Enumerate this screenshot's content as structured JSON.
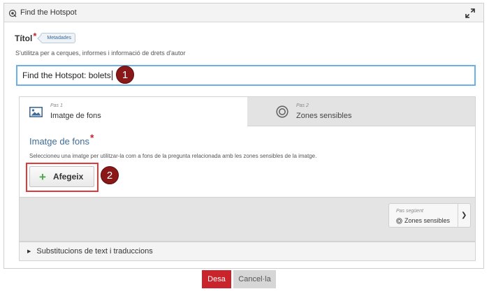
{
  "panel": {
    "title": "Find the Hotspot"
  },
  "title_field": {
    "label": "Títol",
    "required_mark": "*",
    "metadata_tag": "Metadades",
    "description": "S'utilitza per a cerques, informes i informació de drets d'autor",
    "value": "Find the Hotspot: bolets"
  },
  "callouts": {
    "first": "1",
    "second": "2"
  },
  "wizard": {
    "steps": [
      {
        "sub": "Pas 1",
        "label": "Imatge de fons",
        "icon": "image-icon",
        "active": true
      },
      {
        "sub": "Pas 2",
        "label": "Zones sensibles",
        "icon": "target-icon",
        "active": false
      }
    ],
    "section_title": "Imatge de fons",
    "required_mark": "*",
    "section_description": "Seleccioneu una imatge per utilitzar-la com a fons de la pregunta relacionada amb les zones sensibles de la imatge.",
    "add_button_label": "Afegeix",
    "next": {
      "sub": "Pas següent",
      "label": "Zones sensibles"
    }
  },
  "collapsible": {
    "label": "Substitucions de text i traduccions"
  },
  "actions": {
    "save_label": "Desa",
    "cancel_label": "Cancel·la"
  },
  "colors": {
    "accent_blue": "#3f6b97",
    "save_red": "#c9232c",
    "callout_red": "#8a1818",
    "highlight_red": "#e03a3a"
  }
}
